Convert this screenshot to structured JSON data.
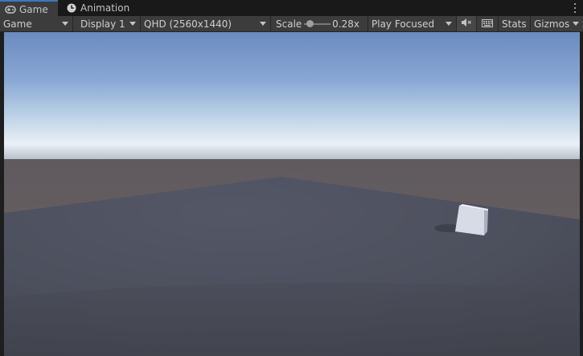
{
  "tabs": [
    {
      "label": "Game",
      "icon": "gamepad-icon",
      "active": true
    },
    {
      "label": "Animation",
      "icon": "clock-icon",
      "active": false
    }
  ],
  "toolbar": {
    "view_select": "Game",
    "display": "Display 1",
    "resolution": "QHD (2560x1440)",
    "scale_label": "Scale",
    "scale_value": "0.28x",
    "scale_fraction": 0.1,
    "play_mode": "Play Focused",
    "mute_icon": "audio-mute-icon",
    "keyboard_icon": "keyboard-icon",
    "stats_label": "Stats",
    "gizmos_label": "Gizmos"
  },
  "colors": {
    "sky_top": "#6e8ec2",
    "horizon": "#e4ecf4",
    "ground": "#4c4f5c",
    "accent": "#3a79bb"
  }
}
